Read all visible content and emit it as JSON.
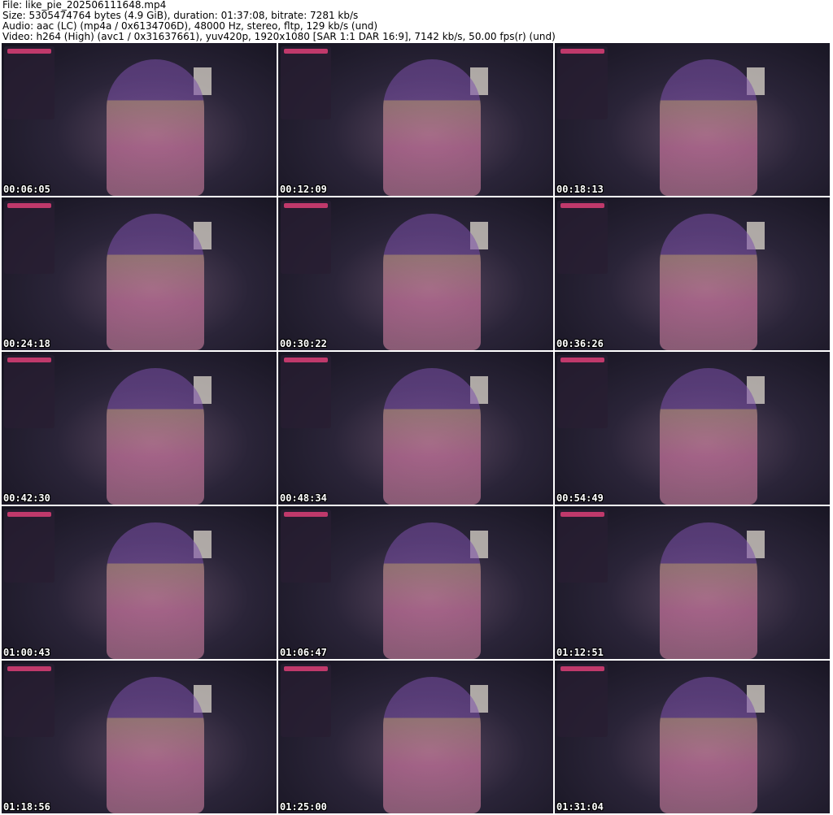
{
  "header": {
    "file": "File: like_pie_202506111648.mp4",
    "size": "Size: 5305474764 bytes (4.9 GiB), duration: 01:37:08, bitrate: 7281 kb/s",
    "audio": "Audio: aac (LC) (mp4a / 0x6134706D), 48000 Hz, stereo, fltp, 129 kb/s (und)",
    "video": "Video: h264 (High) (avc1 / 0x31637661), yuv420p, 1920x1080 [SAR 1:1 DAR 16:9], 7142 kb/s, 50.00 fps(r) (und)"
  },
  "thumbnails": [
    {
      "timestamp": "00:06:05"
    },
    {
      "timestamp": "00:12:09"
    },
    {
      "timestamp": "00:18:13"
    },
    {
      "timestamp": "00:24:18"
    },
    {
      "timestamp": "00:30:22"
    },
    {
      "timestamp": "00:36:26"
    },
    {
      "timestamp": "00:42:30"
    },
    {
      "timestamp": "00:48:34"
    },
    {
      "timestamp": "00:54:49"
    },
    {
      "timestamp": "01:00:43"
    },
    {
      "timestamp": "01:06:47"
    },
    {
      "timestamp": "01:12:51"
    },
    {
      "timestamp": "01:18:56"
    },
    {
      "timestamp": "01:25:00"
    },
    {
      "timestamp": "01:31:04"
    }
  ]
}
